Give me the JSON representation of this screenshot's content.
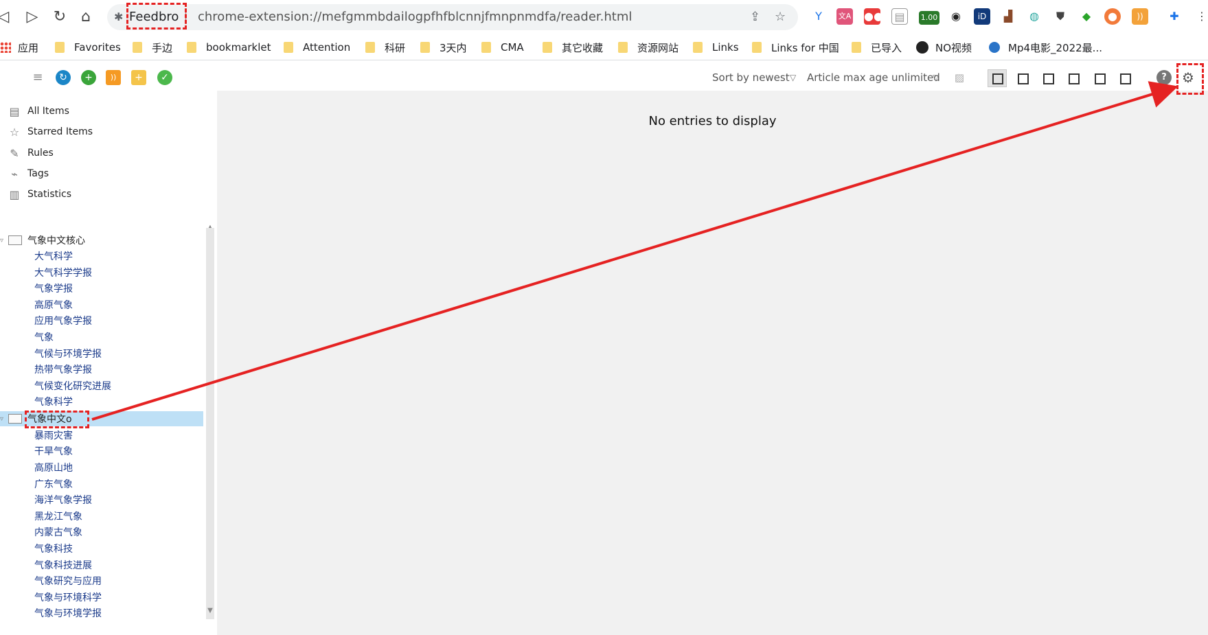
{
  "browser": {
    "site_chip": "Feedbro",
    "url": "chrome-extension://mefgmmbdailogpfhfblcnnjfmnpnmdfa/reader.html",
    "extension_badge": "1.00"
  },
  "bookmarks": [
    {
      "label": "应用"
    },
    {
      "label": "Favorites"
    },
    {
      "label": "手边"
    },
    {
      "label": "bookmarklet"
    },
    {
      "label": "Attention"
    },
    {
      "label": "科研"
    },
    {
      "label": "3天内"
    },
    {
      "label": "CMA"
    },
    {
      "label": "其它收藏"
    },
    {
      "label": "资源网站"
    },
    {
      "label": "Links"
    },
    {
      "label": "Links for 中国"
    },
    {
      "label": "已导入"
    },
    {
      "label": "NO视频"
    },
    {
      "label": "Mp4电影_2022最..."
    }
  ],
  "toolbar": {
    "sort_label": "Sort by newest",
    "age_label": "Article max age unlimited"
  },
  "sidebar": {
    "nav": [
      {
        "label": "All Items",
        "icon": "list-icon"
      },
      {
        "label": "Starred Items",
        "icon": "star-icon"
      },
      {
        "label": "Rules",
        "icon": "wrench-icon"
      },
      {
        "label": "Tags",
        "icon": "tag-icon"
      },
      {
        "label": "Statistics",
        "icon": "bar-chart-icon"
      }
    ],
    "folders": [
      {
        "label": "气象中文核心",
        "feeds": [
          "大气科学",
          "大气科学学报",
          "气象学报",
          "高原气象",
          "应用气象学报",
          "气象",
          "气候与环境学报",
          "热带气象学报",
          "气候变化研究进展",
          "气象科学"
        ]
      },
      {
        "label": "气象中文o",
        "selected": true,
        "feeds": [
          "暴雨灾害",
          "干旱气象",
          "高原山地",
          "广东气象",
          "海洋气象学报",
          "黑龙江气象",
          "内蒙古气象",
          "气象科技",
          "气象科技进展",
          "气象研究与应用",
          "气象与环境科学",
          "气象与环境学报"
        ]
      }
    ]
  },
  "content": {
    "empty_message": "No entries to display"
  },
  "colors": {
    "annotation": "#e52222",
    "selection": "#bee0f6",
    "content_bg": "#f1f1f1",
    "feed_link": "#1a3a8a"
  }
}
